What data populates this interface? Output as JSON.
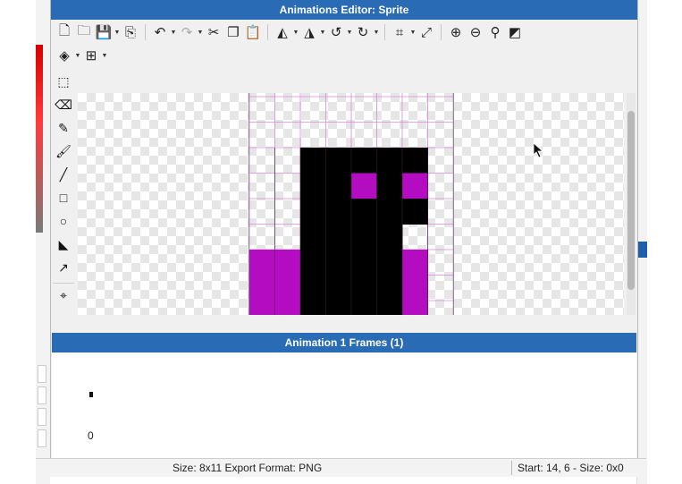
{
  "window": {
    "title": "Animations Editor: Sprite"
  },
  "toolbar": {
    "row1": [
      {
        "icon": "new-file-icon",
        "glyph": "🗋"
      },
      {
        "icon": "open-folder-icon",
        "glyph": "🗀"
      },
      {
        "icon": "save-icon",
        "glyph": "💾"
      },
      {
        "icon": "export-icon",
        "glyph": "⎘"
      },
      {
        "icon": "undo-icon",
        "glyph": "↶"
      },
      {
        "icon": "redo-icon",
        "glyph": "↷"
      },
      {
        "icon": "cut-icon",
        "glyph": "✂"
      },
      {
        "icon": "copy-icon",
        "glyph": "❐"
      },
      {
        "icon": "paste-icon",
        "glyph": "📋"
      },
      {
        "icon": "flip-horizontal-icon",
        "glyph": "◭"
      },
      {
        "icon": "flip-vertical-icon",
        "glyph": "◮"
      },
      {
        "icon": "rotate-left-icon",
        "glyph": "↺"
      },
      {
        "icon": "rotate-right-icon",
        "glyph": "↻"
      },
      {
        "icon": "crop-icon",
        "glyph": "⌗"
      },
      {
        "icon": "resize-icon",
        "glyph": "⤢"
      },
      {
        "icon": "zoom-in-icon",
        "glyph": "⊕"
      },
      {
        "icon": "zoom-out-icon",
        "glyph": "⊖"
      },
      {
        "icon": "zoom-fit-icon",
        "glyph": "⚲"
      },
      {
        "icon": "toggle-background-icon",
        "glyph": "◩"
      }
    ],
    "row2": [
      {
        "icon": "layers-icon",
        "glyph": "◈"
      },
      {
        "icon": "grid-icon",
        "glyph": "⊞"
      }
    ]
  },
  "tools": [
    {
      "icon": "marquee-select-icon",
      "glyph": "⬚"
    },
    {
      "icon": "eraser-icon",
      "glyph": "⌫"
    },
    {
      "icon": "pencil-icon",
      "glyph": "✎"
    },
    {
      "icon": "brush-icon",
      "glyph": "🖌"
    },
    {
      "icon": "line-icon",
      "glyph": "╱"
    },
    {
      "icon": "rectangle-icon",
      "glyph": "□"
    },
    {
      "icon": "ellipse-icon",
      "glyph": "○"
    },
    {
      "icon": "paint-bucket-icon",
      "glyph": "◣"
    },
    {
      "icon": "eyedropper-icon",
      "glyph": "↗"
    },
    {
      "icon": "origin-icon",
      "glyph": "⌖"
    }
  ],
  "sprite": {
    "palette": {
      "black": "#000000",
      "magenta": "#b40cc0",
      "grid": "#d68ad8"
    },
    "rows": [
      "........",
      "........",
      "..KKKKK.",
      "..KKMKM.",
      "..KKKKK.",
      "..KKKK..",
      "MMKKKKM.",
      "MMKKKKM.",
      "MMKKKKM."
    ]
  },
  "frames_panel": {
    "header": "Animation 1 Frames (1)",
    "frame_index": "0"
  },
  "status": {
    "left": "Size: 8x11   Export Format: PNG",
    "right": "Start: 14, 6 - Size: 0x0"
  },
  "colors": {
    "title_bar": "#2a6bb5",
    "panel_header": "#2a6bb5"
  }
}
